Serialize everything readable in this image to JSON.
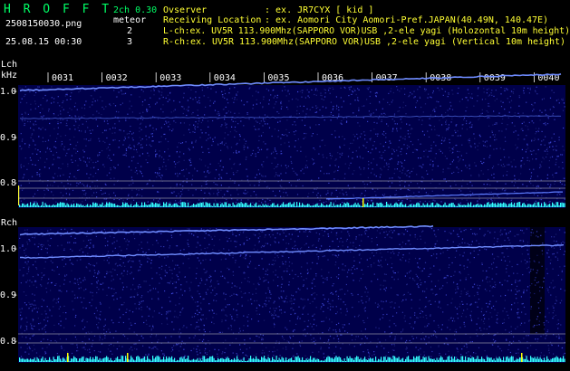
{
  "header": {
    "app_title": "H R O F F T",
    "version": "2ch 0.30",
    "filename": "2508150030.png",
    "timestamp": "25.08.15 00:30",
    "meteor_label": "meteor",
    "meteor_lch": "2",
    "meteor_rch": "3",
    "observer_label": "Ovserver",
    "observer_value": ": ex. JR7CYX [ kid ]",
    "location_label": "Receiving Location",
    "location_value": ": ex. Aomori City Aomori-Pref.JAPAN(40.49N, 140.47E)",
    "lch_info": "L-ch:ex. UV5R 113.900Mhz(SAPPORO VOR)USB ,2-ele yagi (Holozontal 10m height)",
    "rch_info": "R-ch:ex. UV5R 113.900Mhz(SAPPORO VOR)USB ,2-ele yagi (Vertical 10m height)"
  },
  "time_axis": {
    "labels": [
      "0031",
      "0032",
      "0033",
      "0034",
      "0035",
      "0036",
      "0037",
      "0038",
      "0039",
      "0040"
    ]
  },
  "lch": {
    "channel_label": "Lch",
    "unit_label": "kHz",
    "freq_labels": [
      "1.0",
      "0.9",
      "0.8"
    ]
  },
  "rch": {
    "channel_label": "Rch",
    "freq_labels": [
      "1.0",
      "0.9",
      "0.8"
    ]
  },
  "colors": {
    "title_green": "#00ff66",
    "text_white": "#ffffff",
    "marker_yellow": "#ffff33",
    "level_cyan": "#33ffff",
    "level_yellow": "#ffff00",
    "panel_bg": "#00004a",
    "trace_blue": "#6f8cff"
  }
}
